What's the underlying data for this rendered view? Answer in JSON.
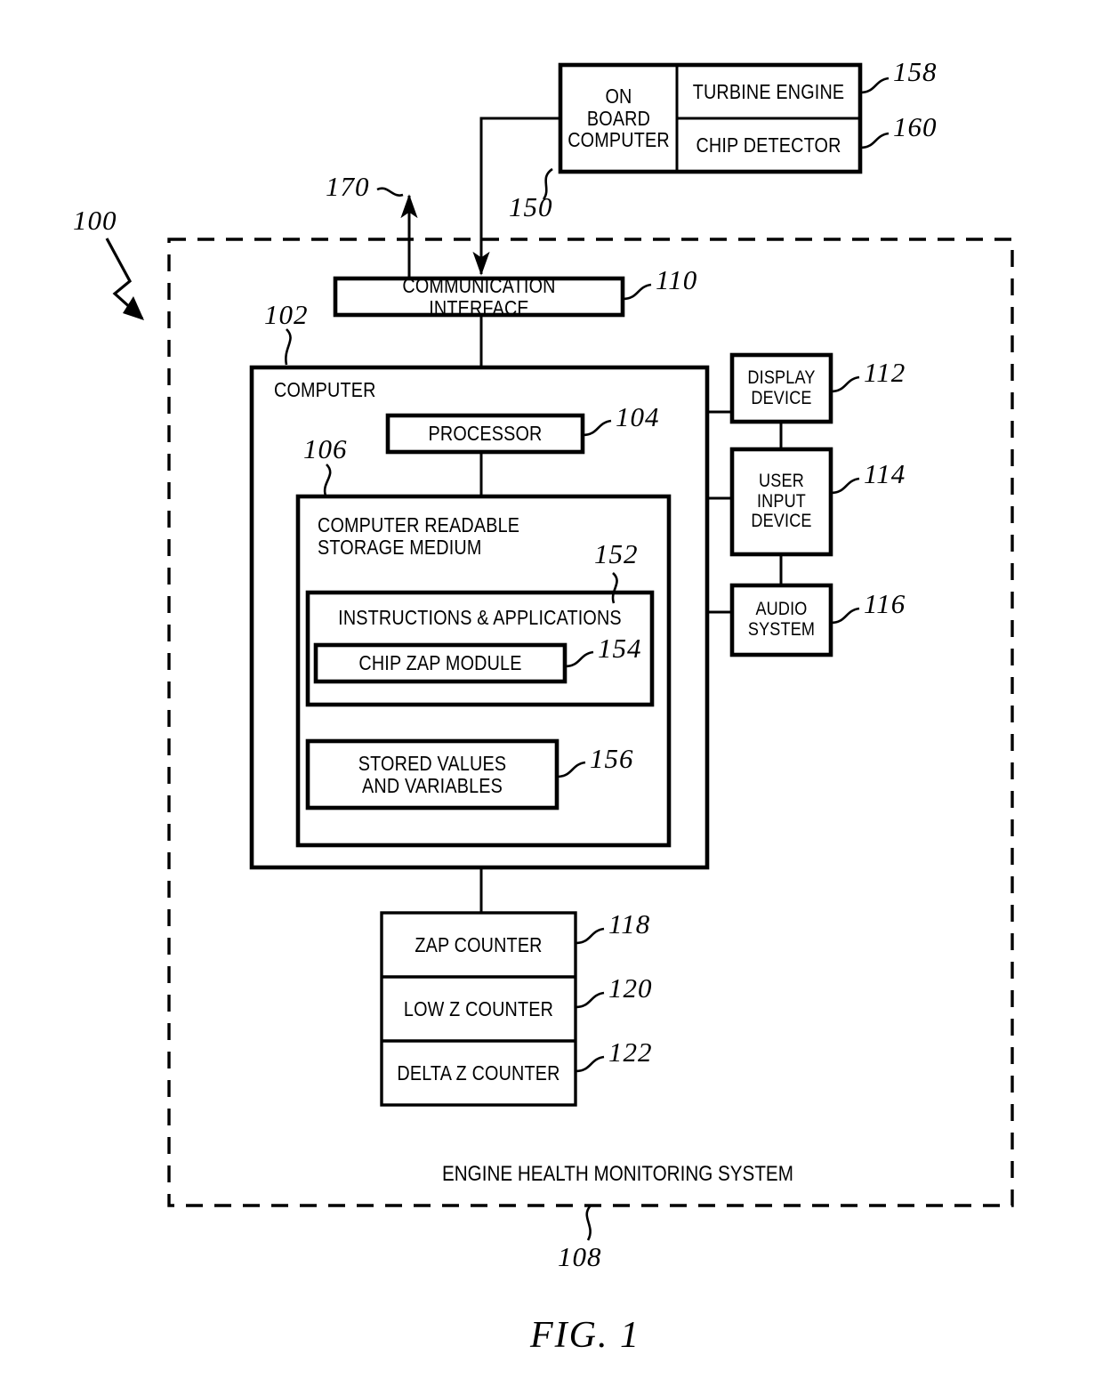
{
  "figure": {
    "caption": "FIG. 1",
    "system_boundary_label": "ENGINE HEALTH MONITORING SYSTEM",
    "system_boundary_ref": "108",
    "system_ref": "100"
  },
  "external": {
    "on_board_computer": {
      "label": "ON\nBOARD\nCOMPUTER",
      "ref": "150"
    },
    "turbine_engine": {
      "label": "TURBINE ENGINE",
      "ref": "158"
    },
    "chip_detector": {
      "label": "CHIP DETECTOR",
      "ref": "160"
    }
  },
  "links": {
    "outbound_ref": "170"
  },
  "blocks": {
    "communication_interface": {
      "label": "COMMUNICATION INTERFACE",
      "ref": "110"
    },
    "computer": {
      "label": "COMPUTER",
      "ref": "102"
    },
    "processor": {
      "label": "PROCESSOR",
      "ref": "104"
    },
    "storage_medium": {
      "label": "COMPUTER READABLE\nSTORAGE MEDIUM",
      "ref": "106"
    },
    "instructions_applications": {
      "label": "INSTRUCTIONS & APPLICATIONS",
      "ref": "152"
    },
    "chip_zap_module": {
      "label": "CHIP ZAP MODULE",
      "ref": "154"
    },
    "stored_values": {
      "label": "STORED VALUES\nAND VARIABLES",
      "ref": "156"
    },
    "display_device": {
      "label": "DISPLAY\nDEVICE",
      "ref": "112"
    },
    "user_input_device": {
      "label": "USER\nINPUT\nDEVICE",
      "ref": "114"
    },
    "audio_system": {
      "label": "AUDIO\nSYSTEM",
      "ref": "116"
    },
    "zap_counter": {
      "label": "ZAP COUNTER",
      "ref": "118"
    },
    "low_z_counter": {
      "label": "LOW Z COUNTER",
      "ref": "120"
    },
    "delta_z_counter": {
      "label": "DELTA Z COUNTER",
      "ref": "122"
    }
  },
  "colors": {
    "ink": "#000000",
    "paper": "#ffffff"
  }
}
